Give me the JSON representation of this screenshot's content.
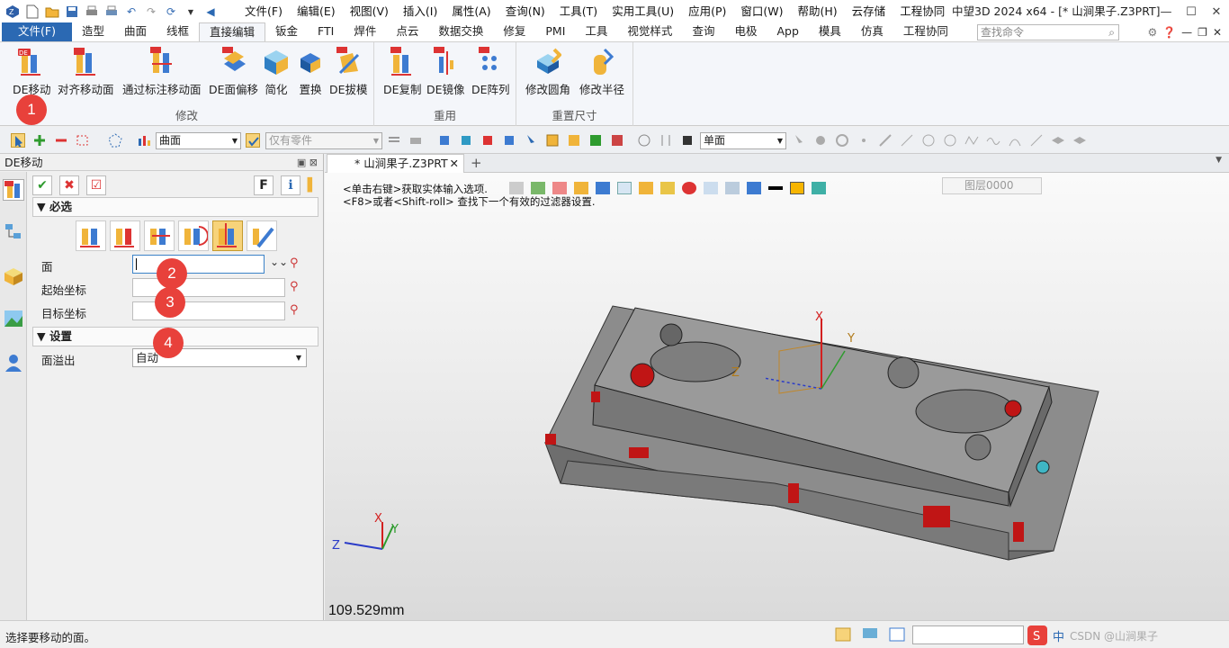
{
  "menubar": {
    "items": [
      "文件(F)",
      "编辑(E)",
      "视图(V)",
      "插入(I)",
      "属性(A)",
      "查询(N)",
      "工具(T)",
      "实用工具(U)",
      "应用(P)",
      "窗口(W)",
      "帮助(H)",
      "云存储",
      "工程协同"
    ],
    "window_title": "中望3D 2024 x64 - [* 山涧果子.Z3PRT]"
  },
  "tabs": [
    "文件(F)",
    "造型",
    "曲面",
    "线框",
    "直接编辑",
    "钣金",
    "FTI",
    "焊件",
    "点云",
    "数据交换",
    "修复",
    "PMI",
    "工具",
    "视觉样式",
    "查询",
    "电极",
    "App",
    "模具",
    "仿真",
    "工程协同"
  ],
  "active_tab": "直接编辑",
  "command_search": {
    "placeholder": "查找命令"
  },
  "ribbon": {
    "groups": [
      {
        "label": "修改",
        "buttons": [
          "DE移动",
          "对齐移动面",
          "通过标注移动面",
          "DE面偏移",
          "简化",
          "置换",
          "DE拔模"
        ]
      },
      {
        "label": "重用",
        "buttons": [
          "DE复制",
          "DE镜像",
          "DE阵列"
        ]
      },
      {
        "label": "重置尺寸",
        "buttons": [
          "修改圆角",
          "修改半径"
        ]
      }
    ]
  },
  "toolbar2": {
    "filter_combo": "曲面",
    "scope_combo": "仅有零件",
    "select_mode": "单面"
  },
  "left_panel": {
    "title": "DE移动",
    "section_required": "必选",
    "fields": [
      {
        "label": "面",
        "value": ""
      },
      {
        "label": "起始坐标",
        "value": ""
      },
      {
        "label": "目标坐标",
        "value": ""
      }
    ],
    "section_settings": "设置",
    "overflow_label": "面溢出",
    "overflow_value": "自动",
    "f_button": "F"
  },
  "badges": [
    "1",
    "2",
    "3",
    "4"
  ],
  "document_tab": "* 山涧果子.Z3PRT",
  "viewport": {
    "hint1": "<单击右键>获取实体输入选项.",
    "hint2": "<F8>或者<Shift-roll> 查找下一个有效的过滤器设置.",
    "layer": "图层0000",
    "scale": "109.529mm",
    "axis_labels": {
      "x": "X",
      "y": "Y",
      "z": "Z"
    }
  },
  "status": {
    "message": "选择要移动的面。",
    "ime": "中",
    "watermark": "CSDN @山涧果子"
  },
  "colors": {
    "file_tab": "#2b69b3",
    "badge": "#e8413b",
    "model_gray": "#8c8c8c",
    "hole_red": "#d01818"
  }
}
